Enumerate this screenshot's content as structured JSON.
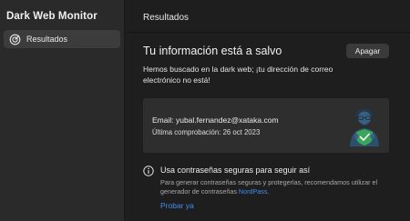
{
  "sidebar": {
    "app_title": "Dark Web Monitor",
    "items": [
      {
        "label": "Resultados",
        "icon": "target-icon",
        "selected": true
      }
    ]
  },
  "main": {
    "page_title": "Resultados",
    "status": {
      "heading": "Tu información está a salvo",
      "off_button": "Apagar",
      "description": "Hemos buscado en la dark web; ¡tu dirección de correo electrónico no está!"
    },
    "card": {
      "email_line": "Email: yubal.fernandez@xataka.com",
      "last_check": "Última comprobación: 26 oct 2023",
      "illustration": "person-shield-illustration"
    },
    "tip": {
      "icon": "info-icon",
      "title": "Usa contraseñas seguras para seguir así",
      "body": "Para generar contraseñas seguras y protegerlas, recomendamos utilizar el generador de contraseñas",
      "link": "NordPass.",
      "action": "Probar ya"
    }
  },
  "colors": {
    "background": "#1e1e1e",
    "sidebar": "#2a2a2a",
    "card": "#2e2e2e",
    "accent_link": "#3f8ef5",
    "shield": "#3aa65a"
  }
}
